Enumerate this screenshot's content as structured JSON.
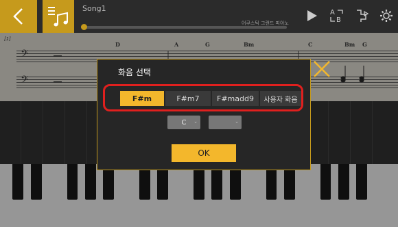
{
  "header": {
    "song_title": "Song1",
    "instrument": "어쿠스틱 그랜드 피아노"
  },
  "score": {
    "bar_label": "[1]",
    "chords": [
      "D",
      "A",
      "G",
      "Bm",
      "C",
      "Bm",
      "G"
    ]
  },
  "dialog": {
    "title": "화음 선택",
    "chord_options": [
      {
        "label": "F#m",
        "selected": true
      },
      {
        "label": "F#m7",
        "selected": false
      },
      {
        "label": "F#madd9",
        "selected": false
      },
      {
        "label": "사용자 화음",
        "selected": false
      }
    ],
    "root_select_value": "C",
    "type_select_value": "",
    "ok_label": "OK"
  },
  "colors": {
    "accent": "#f3b72c",
    "accent_dark": "#c69a1c",
    "highlight": "#e0201e"
  }
}
